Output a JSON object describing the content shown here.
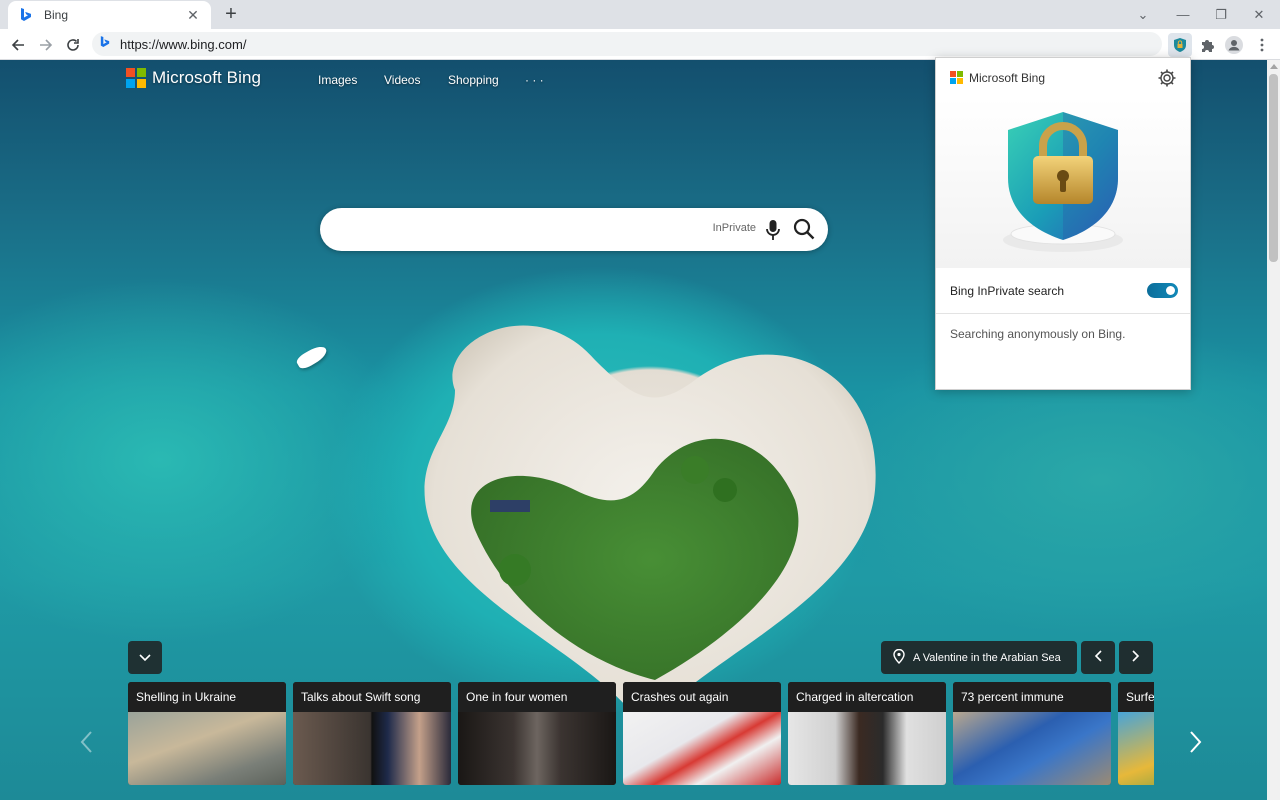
{
  "browser": {
    "tab": {
      "title": "Bing",
      "close": "✕"
    },
    "new_tab": "+",
    "window": {
      "minimize": "—",
      "restore": "❐",
      "close": "✕",
      "tab_search": "⌄"
    },
    "address": {
      "url": "https://www.bing.com/"
    }
  },
  "page": {
    "logo": {
      "wordmark": "Microsoft Bing"
    },
    "nav": {
      "images": "Images",
      "videos": "Videos",
      "shopping": "Shopping",
      "more": "· · ·"
    },
    "search": {
      "placeholder": "",
      "inprivate_label": "InPrivate"
    },
    "location": {
      "label": "A Valentine in the Arabian Sea"
    },
    "cards": [
      {
        "caption": "Shelling in Ukraine"
      },
      {
        "caption": "Talks about Swift song"
      },
      {
        "caption": "One in four women"
      },
      {
        "caption": "Crashes out again"
      },
      {
        "caption": "Charged in altercation"
      },
      {
        "caption": "73 percent immune"
      },
      {
        "caption": "Surfer"
      }
    ]
  },
  "popup": {
    "brand": "Microsoft Bing",
    "toggle_label": "Bing InPrivate search",
    "toggle_state": "on",
    "status": "Searching anonymously on Bing."
  },
  "colors": {
    "accent_toggle": "#0b6e9b",
    "ms_red": "#f25022",
    "ms_green": "#7fba00",
    "ms_blue": "#00a4ef",
    "ms_yellow": "#ffb900"
  }
}
